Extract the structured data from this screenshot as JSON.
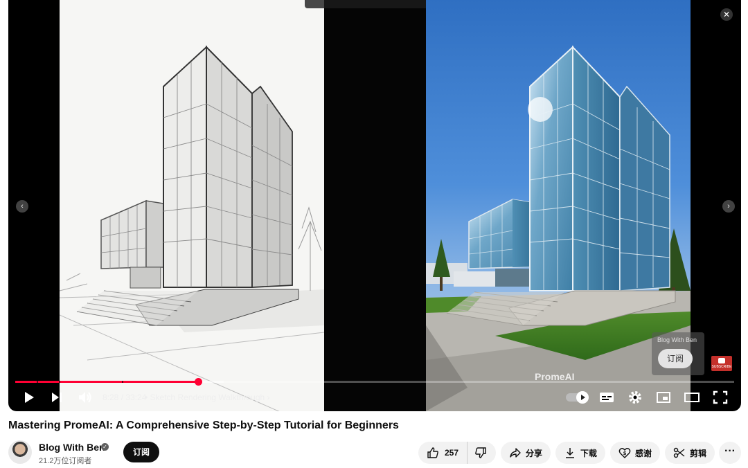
{
  "player": {
    "watermark": "PromeAI",
    "end_card": {
      "channel": "Blog With Ben",
      "subscribe_label": "订阅",
      "badge_text": "SUBSCRIBE"
    },
    "progress": {
      "played_fraction": 0.2546,
      "buffered_fraction": 0.29
    },
    "time": "8:28 / 33:24",
    "chapter": "• Sketch Rendering Walkthrough",
    "accent_color": "#ff0033"
  },
  "video": {
    "title": "Mastering PromeAI: A Comprehensive Step-by-Step Tutorial for Beginners"
  },
  "channel": {
    "name": "Blog With Ben",
    "subscribers": "21.2万位订阅者",
    "subscribe_label": "订阅"
  },
  "actions": {
    "like_count": "257",
    "share_label": "分享",
    "download_label": "下载",
    "thanks_label": "感谢",
    "clip_label": "剪辑",
    "more_label": "···"
  },
  "icons": [
    "close-icon",
    "chevron-left-icon",
    "chevron-right-icon",
    "play-icon",
    "next-icon",
    "volume-icon",
    "autoplay-toggle-icon",
    "captions-icon",
    "settings-gear-icon",
    "miniplayer-icon",
    "theater-mode-icon",
    "fullscreen-icon",
    "thumbs-up-icon",
    "thumbs-down-icon",
    "share-icon",
    "download-icon",
    "thanks-icon",
    "scissors-icon",
    "verified-icon"
  ]
}
